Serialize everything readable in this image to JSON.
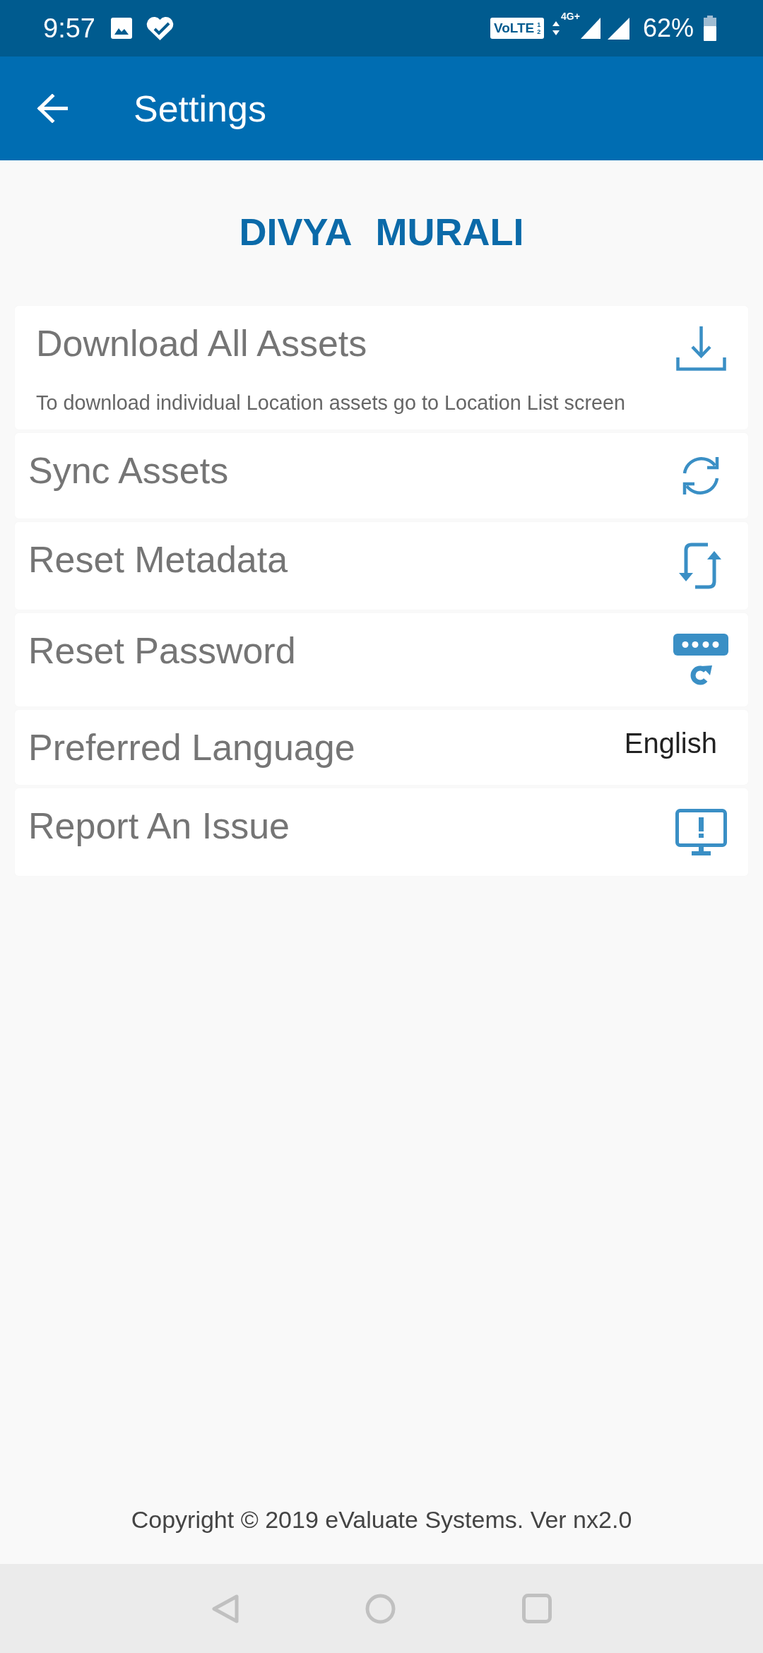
{
  "status_bar": {
    "time": "9:57",
    "volte_badge": {
      "label": "VoLTE",
      "sim_slots": [
        "1",
        "2"
      ]
    },
    "network_type": "4G+",
    "battery": "62%"
  },
  "app_bar": {
    "title": "Settings"
  },
  "profile": {
    "name": "DIVYA MURALI"
  },
  "settings": [
    {
      "kind": "icon",
      "title": "Download All Assets",
      "description": "To download individual Location assets go to Location List screen"
    },
    {
      "kind": "icon",
      "title": "Sync Assets"
    },
    {
      "kind": "icon",
      "title": "Reset Metadata"
    },
    {
      "kind": "icon",
      "title": "Reset Password"
    },
    {
      "kind": "value",
      "title": "Preferred Language",
      "value": "English"
    },
    {
      "kind": "icon",
      "title": "Report An Issue"
    }
  ],
  "footer": {
    "copyright": "Copyright © 2019 eValuate Systems. Ver nx2.0"
  }
}
